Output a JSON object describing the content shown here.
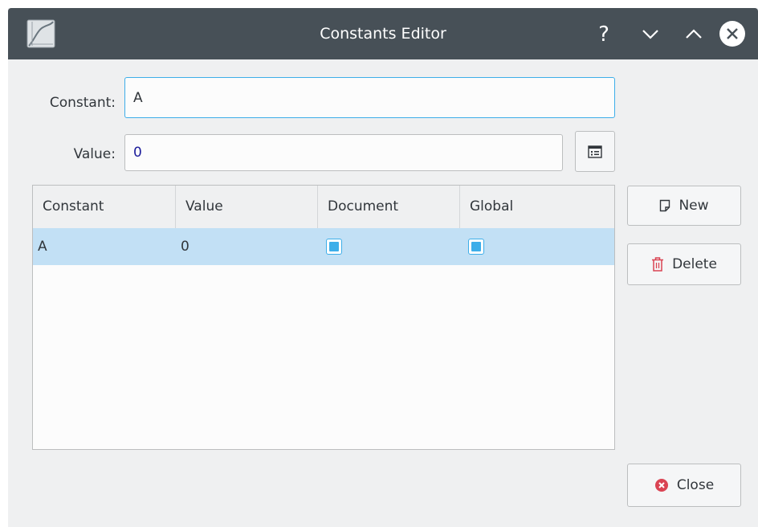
{
  "window": {
    "title": "Constants Editor",
    "controls": {
      "help_glyph": "?",
      "minimize_icon": "chevron-down-icon",
      "maximize_icon": "chevron-up-icon",
      "close_icon": "close-circle-icon"
    },
    "app_icon": "kmplot-icon"
  },
  "form": {
    "constant_label": "Constant:",
    "constant_value": "A",
    "value_label": "Value:",
    "value_value": "0",
    "editor_icon": "equation-editor-icon"
  },
  "table": {
    "columns": [
      "Constant",
      "Value",
      "Document",
      "Global"
    ],
    "rows": [
      {
        "constant": "A",
        "value": "0",
        "document": true,
        "global": true
      }
    ]
  },
  "buttons": {
    "new_label": "New",
    "new_icon": "document-new-icon",
    "delete_label": "Delete",
    "delete_icon": "trash-icon",
    "close_label": "Close",
    "close_icon": "close-circle-icon"
  },
  "colors": {
    "titlebar": "#475057",
    "accent": "#3daee9",
    "selection": "#c2e0f5",
    "delete_red": "#da4453"
  }
}
